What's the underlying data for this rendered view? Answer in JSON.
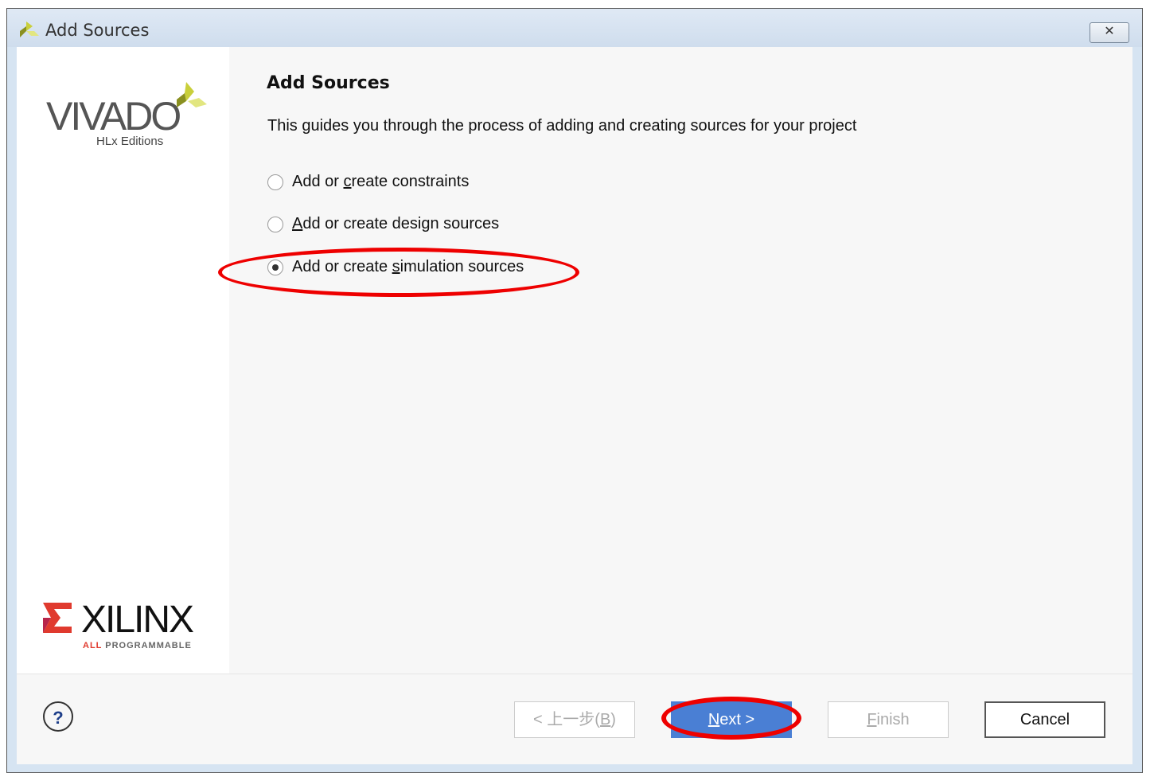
{
  "window": {
    "title": "Add Sources",
    "close_icon": "close-icon"
  },
  "branding": {
    "vivado": "VIVADO",
    "vivado_sub": "HLx Editions",
    "xilinx": "XILINX",
    "xilinx_tag_a": "ALL",
    "xilinx_tag_b": "PROGRAMMABLE"
  },
  "main": {
    "heading": "Add Sources",
    "description": "This guides you through the process of adding and creating sources for your project",
    "options": [
      {
        "pre": "Add or ",
        "key": "c",
        "post": "reate constraints",
        "selected": false
      },
      {
        "pre": "",
        "key": "A",
        "post": "dd or create design sources",
        "selected": false
      },
      {
        "pre": "Add or create ",
        "key": "s",
        "post": "imulation sources",
        "selected": true
      }
    ]
  },
  "footer": {
    "help": "?",
    "back": {
      "pre": "< 上一步(",
      "key": "B",
      "post": ")"
    },
    "next": {
      "key": "N",
      "post": "ext >"
    },
    "finish": {
      "key": "F",
      "post": "inish"
    },
    "cancel": "Cancel"
  },
  "colors": {
    "accent": "#4a7fd4",
    "annotation": "#ee0000"
  }
}
